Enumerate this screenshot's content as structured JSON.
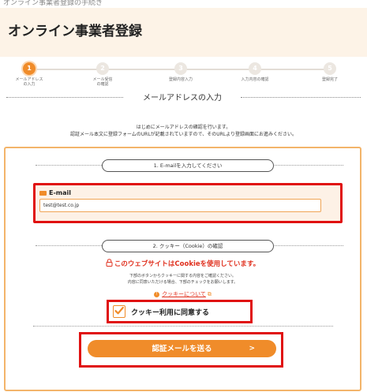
{
  "breadcrumb": "オンライン事業者登録の手続き",
  "header": {
    "title": "オンライン事業者登録"
  },
  "steps": [
    {
      "num": "1",
      "label": "メールアドレス\nの入力",
      "active": true
    },
    {
      "num": "2",
      "label": "メール受信\nの確認",
      "active": false
    },
    {
      "num": "3",
      "label": "登録内容入力",
      "active": false
    },
    {
      "num": "4",
      "label": "入力内容の確認",
      "active": false
    },
    {
      "num": "5",
      "label": "登録完了",
      "active": false
    }
  ],
  "section_title": "メールアドレスの入力",
  "intro": {
    "line1": "はじめにメールアドレスの確認を行います。",
    "line2": "認証メール本文に登録フォームのURLが記載されていますので、そのURLより登録画面にお進みください。"
  },
  "email_section": {
    "heading": "1. E-mailを入力してください",
    "label": "E-mail",
    "value": "test@test.co.jp"
  },
  "cookie_section": {
    "heading": "2. クッキー（Cookie）の確認",
    "warning": "このウェブサイトはCookieを使用しています。",
    "note1": "下部のボタンからクッキーに関する内容をご確認ください。",
    "note2": "内容に同意いただける場合、下部のチェックをお願いします。",
    "link": "クッキーについて",
    "agree_label": "クッキー利用に同意する",
    "agree_checked": true
  },
  "submit": {
    "label": "認証メールを送る",
    "arrow": ">"
  },
  "colors": {
    "accent": "#f08c2a",
    "highlight": "#e01010",
    "warn": "#e0301e"
  }
}
